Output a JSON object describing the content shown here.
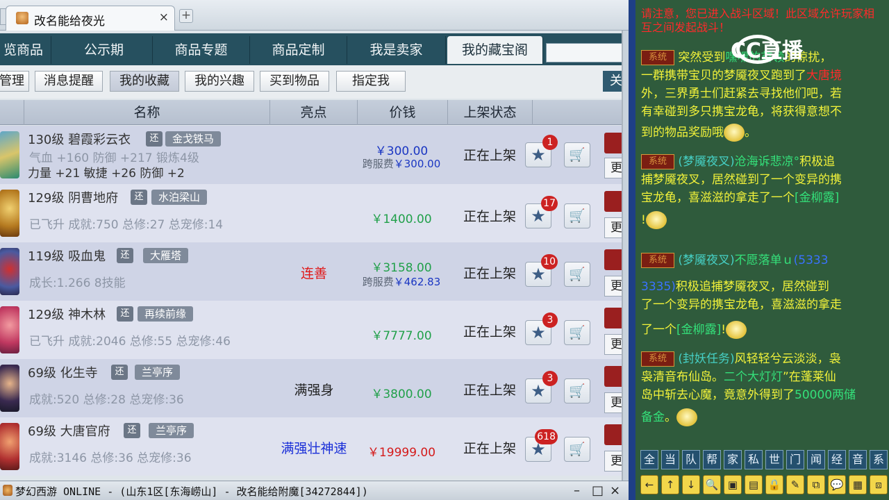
{
  "browser": {
    "tab_title": "改名能给夜光",
    "tab_close": "×",
    "new_tab": "+"
  },
  "main_tabs": [
    {
      "label": "览商品"
    },
    {
      "label": "公示期"
    },
    {
      "label": "商品专题"
    },
    {
      "label": "商品定制"
    },
    {
      "label": "我是卖家"
    },
    {
      "label": "我的藏宝阁"
    }
  ],
  "sub_tabs": [
    {
      "label": "管理"
    },
    {
      "label": "消息提醒"
    },
    {
      "label": "我的收藏"
    },
    {
      "label": "我的兴趣"
    },
    {
      "label": "买到物品"
    },
    {
      "label": "指定我"
    }
  ],
  "sub_right": "关",
  "table": {
    "headers": [
      "名称",
      "亮点",
      "价钱",
      "上架状态"
    ],
    "rows": [
      {
        "name": "130级 碧霞彩云衣",
        "huan": "还",
        "server": "金戈铁马",
        "desc1": "气血 +160 防御 +217 锻炼4级",
        "desc2": "力量 +21 敏捷 +26 防御 +2",
        "highlight": "",
        "price": "￥300.00",
        "cross_label": "跨服费",
        "cross_fee": "￥300.00",
        "status": "正在上架",
        "fav_count": "1",
        "buy": "购",
        "more": "更"
      },
      {
        "name": "129级 阴曹地府",
        "huan": "还",
        "server": "水泊梁山",
        "desc1": "已飞升 成就:750 总修:27 总宠修:14",
        "desc2": "",
        "highlight": "",
        "price": "￥1400.00",
        "cross_label": "",
        "cross_fee": "",
        "status": "正在上架",
        "fav_count": "17",
        "buy": "购",
        "more": "更"
      },
      {
        "name": "119级 吸血鬼",
        "huan": "还",
        "server": "大雁塔",
        "desc1": "成长:1.266 8技能",
        "desc2": "",
        "highlight": "连善",
        "price": "￥3158.00",
        "cross_label": "跨服费",
        "cross_fee": "￥462.83",
        "status": "正在上架",
        "fav_count": "10",
        "buy": "购",
        "more": "更"
      },
      {
        "name": "129级 神木林",
        "huan": "还",
        "server": "再续前缘",
        "desc1": "已飞升 成就:2046 总修:55 总宠修:46",
        "desc2": "",
        "highlight": "",
        "price": "￥7777.00",
        "cross_label": "",
        "cross_fee": "",
        "status": "正在上架",
        "fav_count": "3",
        "buy": "购",
        "more": "更"
      },
      {
        "name": "69级 化生寺",
        "huan": "还",
        "server": "兰亭序",
        "desc1": "成就:520 总修:28 总宠修:36",
        "desc2": "",
        "highlight": "满强身",
        "price": "￥3800.00",
        "cross_label": "",
        "cross_fee": "",
        "status": "正在上架",
        "fav_count": "3",
        "buy": "购",
        "more": "更"
      },
      {
        "name": "69级 大唐官府",
        "huan": "还",
        "server": "兰亭序",
        "desc1": "成就:3146 总修:36 总宠修:36",
        "desc2": "",
        "highlight": "满强壮神速",
        "price": "￥19999.00",
        "cross_label": "",
        "cross_fee": "",
        "status": "正在上架",
        "fav_count": "618",
        "buy": "购",
        "more": "更"
      }
    ]
  },
  "taskbar": {
    "title": "梦幻西游 ONLINE - (山东1区[东海崂山] - 改名能给附魔[34272844])",
    "minimize": "–",
    "maximize": "□",
    "close": "×"
  },
  "chat": {
    "logo": "CC直播",
    "top_notice": "请注意，您已进入战斗区域！此区域允许玩家相互之间发起战斗！",
    "sys_label": "系统",
    "msg1": [
      "突然受到",
      "嘿嘿的首领",
      "的惊扰，",
      "一群携带宝贝的梦魇夜叉跑到了",
      "大唐境",
      "外，三界勇士们赶紧去寻找他们吧，若",
      "有幸碰到多只携宝龙龟，将获得意想不",
      "到的物品奖励哦",
      "。"
    ],
    "msg2": [
      "(梦魇夜叉)",
      "沧海诉悲凉°",
      "积极追",
      "捕梦魇夜叉，居然碰到了一个变异的携",
      "宝龙龟，喜滋滋的拿走了一个",
      "[金柳露]",
      "!"
    ],
    "msg3": [
      "(梦魇夜叉)",
      "不愿落单ｕ",
      "(5333",
      "3335)",
      "积极追捕梦魇夜叉，居然碰到",
      "了一个变异的携宝龙龟，喜滋滋的拿走",
      "了一个",
      "[金柳露]",
      "!"
    ],
    "msg4": [
      "(封妖任务)",
      "风轻轻兮云淡淡，袅",
      "袅清音布仙岛。",
      "二个大灯灯",
      "”在蓬莱仙",
      "岛中斩去心魔，竟意外得到了",
      "50000两储",
      "备金",
      "。"
    ],
    "channels": [
      "全",
      "当",
      "队",
      "帮",
      "家",
      "私",
      "世",
      "门",
      "闻",
      "经",
      "音",
      "系"
    ],
    "icons": [
      "←",
      "↑",
      "↓",
      "🔍",
      "▣",
      "▤",
      "🔒",
      "✎",
      "⧉",
      "💬",
      "▦",
      "⧈"
    ]
  },
  "colors": {
    "tab_bg": "#26505f",
    "price_green": "#21a04a",
    "price_blue": "#1a36c2",
    "price_red": "#d41a1a",
    "highlight_red": "#e01818",
    "highlight_blue": "#1a2fd8"
  }
}
